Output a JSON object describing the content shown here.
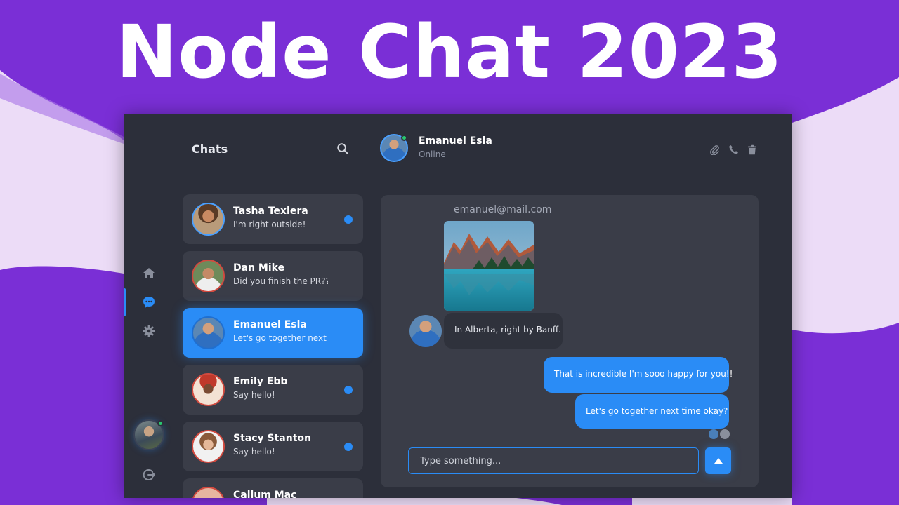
{
  "banner": {
    "title": "Node Chat 2023"
  },
  "colors": {
    "background": "#7a2fd6",
    "accent": "#2a8cf6",
    "panel": "#2c2f3a",
    "card": "#3a3d48",
    "online": "#29c76f"
  },
  "rail": {
    "items": [
      {
        "name": "home",
        "icon": "home-icon",
        "active": false
      },
      {
        "name": "chats",
        "icon": "chat-bubble-icon",
        "active": true
      },
      {
        "name": "settings",
        "icon": "gear-icon",
        "active": false
      }
    ],
    "user_online": true,
    "logout_icon": "logout-icon"
  },
  "chat_list": {
    "title": "Chats",
    "search_icon": "search-icon",
    "items": [
      {
        "name": "Tasha Texiera",
        "preview": "I'm right outside!",
        "unread": true,
        "active": false
      },
      {
        "name": "Dan Mike",
        "preview": "Did you finish the PR??",
        "unread": false,
        "active": false
      },
      {
        "name": "Emanuel Esla",
        "preview": "Let's go together next",
        "unread": false,
        "active": true
      },
      {
        "name": "Emily Ebb",
        "preview": "Say hello!",
        "unread": true,
        "active": false
      },
      {
        "name": "Stacy Stanton",
        "preview": "Say hello!",
        "unread": true,
        "active": false
      },
      {
        "name": "Callum Mac",
        "preview": "",
        "unread": false,
        "active": false
      }
    ]
  },
  "conversation": {
    "contact_name": "Emanuel Esla",
    "contact_status": "Online",
    "header_icons": [
      "paperclip-icon",
      "phone-icon",
      "trash-icon"
    ],
    "sender_email": "emanuel@mail.com",
    "messages": [
      {
        "from": "them",
        "type": "image"
      },
      {
        "from": "them",
        "type": "text",
        "text": "In Alberta, right by Banff."
      },
      {
        "from": "me",
        "type": "text",
        "text": "That is incredible I'm sooo happy for you!!"
      },
      {
        "from": "me",
        "type": "text",
        "text": "Let's go together next time okay?"
      }
    ],
    "input": {
      "placeholder": "Type something...",
      "value": ""
    },
    "send_icon": "send-arrow-up-icon"
  }
}
